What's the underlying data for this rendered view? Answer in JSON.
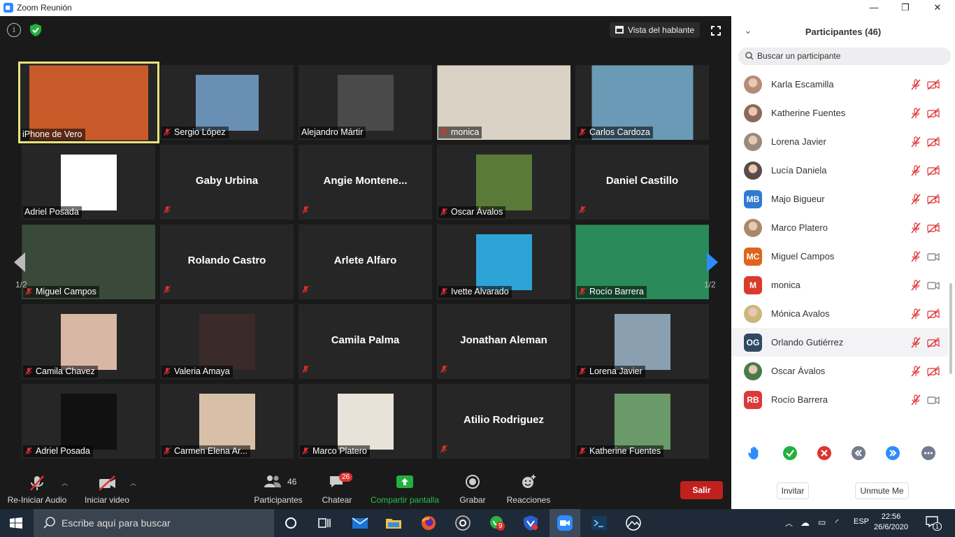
{
  "window": {
    "title": "Zoom Reunión",
    "min": "—",
    "max": "❐",
    "close": "✕"
  },
  "top": {
    "speaker_view": "Vista del hablante"
  },
  "tiles": [
    {
      "name": "iPhone de Vero",
      "video": true,
      "muted": false,
      "active": true,
      "col": 0,
      "row": 0
    },
    {
      "name": "Sergio López",
      "video": true,
      "muted": true,
      "col": 1,
      "row": 0
    },
    {
      "name": "Alejandro Mártir",
      "video": true,
      "muted": false,
      "col": 2,
      "row": 0
    },
    {
      "name": "monica",
      "video": true,
      "muted": true,
      "col": 3,
      "row": 0
    },
    {
      "name": "Carlos Cardoza",
      "video": true,
      "muted": true,
      "col": 4,
      "row": 0
    },
    {
      "name": "Adriel Posada",
      "video": true,
      "muted": false,
      "col": 0,
      "row": 1
    },
    {
      "name": "Gaby Urbina",
      "video": false,
      "muted": true,
      "col": 1,
      "row": 1
    },
    {
      "name": "Angie   Montene...",
      "video": false,
      "muted": true,
      "col": 2,
      "row": 1
    },
    {
      "name": "Oscar Ávalos",
      "video": true,
      "muted": true,
      "col": 3,
      "row": 1
    },
    {
      "name": "Daniel Castillo",
      "video": false,
      "muted": true,
      "col": 4,
      "row": 1
    },
    {
      "name": "Miguel Campos",
      "video": true,
      "muted": true,
      "col": 0,
      "row": 2
    },
    {
      "name": "Rolando Castro",
      "video": false,
      "muted": true,
      "col": 1,
      "row": 2
    },
    {
      "name": "Arlete Alfaro",
      "video": false,
      "muted": true,
      "col": 2,
      "row": 2
    },
    {
      "name": "Ivette Alvarado",
      "video": true,
      "muted": true,
      "col": 3,
      "row": 2
    },
    {
      "name": "Rocío Barrera",
      "video": true,
      "muted": true,
      "col": 4,
      "row": 2
    },
    {
      "name": "Camila Chavez",
      "video": true,
      "muted": true,
      "col": 0,
      "row": 3
    },
    {
      "name": "Valeria Amaya",
      "video": true,
      "muted": true,
      "col": 1,
      "row": 3
    },
    {
      "name": "Camila Palma",
      "video": false,
      "muted": true,
      "col": 2,
      "row": 3
    },
    {
      "name": "Jonathan Aleman",
      "video": false,
      "muted": true,
      "col": 3,
      "row": 3
    },
    {
      "name": "Lorena Javier",
      "video": true,
      "muted": true,
      "col": 4,
      "row": 3
    },
    {
      "name": "Adriel Posada",
      "video": true,
      "muted": true,
      "col": 0,
      "row": 4
    },
    {
      "name": "Carmen Elena Ar...",
      "video": true,
      "muted": true,
      "col": 1,
      "row": 4
    },
    {
      "name": "Marco Platero",
      "video": true,
      "muted": true,
      "col": 2,
      "row": 4
    },
    {
      "name": "Atilio Rodriguez",
      "video": false,
      "muted": true,
      "col": 3,
      "row": 4
    },
    {
      "name": "Katherine Fuentes",
      "video": true,
      "muted": true,
      "col": 4,
      "row": 4
    }
  ],
  "pager": {
    "left": "1/2",
    "right": "1/2"
  },
  "toolbar": {
    "audio": "Re-Iniciar Audio",
    "video": "Iniciar video",
    "participants": "Participantes",
    "participants_count": "46",
    "chat": "Chatear",
    "chat_badge": "26",
    "share": "Compartir pantalla",
    "record": "Grabar",
    "reactions": "Reacciones",
    "leave": "Salir"
  },
  "panel": {
    "title": "Participantes (46)",
    "search_placeholder": "Buscar un participante",
    "participants": [
      {
        "name": "Karla Escamilla",
        "initials": "",
        "color": "#b88a7a",
        "photo": true,
        "cam_on": false
      },
      {
        "name": "Katherine Fuentes",
        "initials": "",
        "color": "#8a6a5a",
        "photo": true,
        "cam_on": false
      },
      {
        "name": "Lorena Javier",
        "initials": "",
        "color": "#9a8a7a",
        "photo": true,
        "cam_on": false
      },
      {
        "name": "Lucía Daniela",
        "initials": "",
        "color": "#5a4a4a",
        "photo": true,
        "cam_on": false
      },
      {
        "name": "Majo Bigueur",
        "initials": "MB",
        "color": "#2f7ad1",
        "photo": false,
        "cam_on": false
      },
      {
        "name": "Marco Platero",
        "initials": "",
        "color": "#a88a6a",
        "photo": true,
        "cam_on": false
      },
      {
        "name": "Miguel Campos",
        "initials": "MC",
        "color": "#e0641c",
        "photo": false,
        "cam_on": true
      },
      {
        "name": "monica",
        "initials": "M",
        "color": "#d93a2b",
        "photo": false,
        "cam_on": true
      },
      {
        "name": "Mónica Avalos",
        "initials": "",
        "color": "#c9b87a",
        "photo": true,
        "cam_on": false
      },
      {
        "name": "Orlando Gutiérrez",
        "initials": "OG",
        "color": "#2e4a63",
        "photo": false,
        "cam_on": false,
        "highlight": true
      },
      {
        "name": "Oscar Ávalos",
        "initials": "",
        "color": "#4a7a4a",
        "photo": true,
        "cam_on": false
      },
      {
        "name": "Rocío Barrera",
        "initials": "RB",
        "color": "#d93a3a",
        "photo": false,
        "cam_on": true
      }
    ],
    "invite": "Invitar",
    "unmute": "Unmute Me"
  },
  "taskbar": {
    "search_placeholder": "Escribe aquí para buscar",
    "whatsapp_badge": "9",
    "lang": "ESP",
    "time": "22:56",
    "date": "26/6/2020",
    "notif": "1"
  },
  "colors": {
    "accent": "#2d8cff",
    "leave": "#c2201d",
    "active_border": "#e9e37c",
    "mic_off": "#e02f2f"
  }
}
